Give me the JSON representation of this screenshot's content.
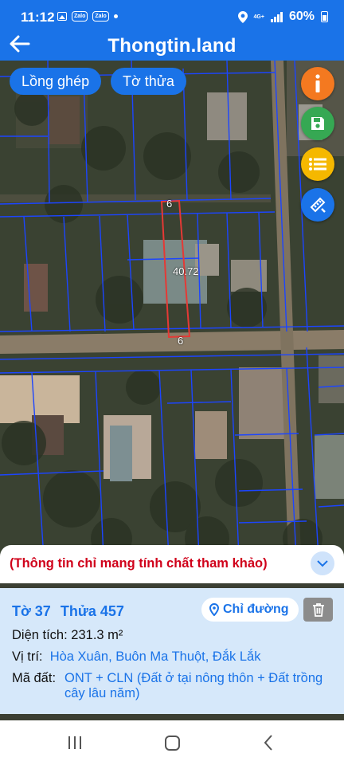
{
  "status_bar": {
    "time": "11:12",
    "notifications": [
      "gallery-icon",
      "zalo-icon",
      "zalo-icon"
    ],
    "zalo_label": "Zalo",
    "network": "4G+",
    "battery": "60%"
  },
  "app_bar": {
    "title": "Thongtin.land"
  },
  "map": {
    "chips": {
      "overlay": "Lồng ghép",
      "parcel": "Tờ thửa"
    },
    "fab_colors": [
      "#f47920",
      "#36a853",
      "#f5b800",
      "#1a73e8"
    ],
    "labels": {
      "top_width": "6",
      "side_length": "40.72",
      "bottom_width": "6"
    }
  },
  "info_panel": {
    "notice": "(Thông tin chỉ mang tính chất tham khảo)",
    "sheet_label": "Tờ 37",
    "parcel_label": "Thửa 457",
    "directions_button": "Chỉ đường",
    "area_key": "Diện tích:",
    "area_value": "231.3 m²",
    "location_key": "Vị trí:",
    "location_value": "Hòa Xuân, Buôn Ma Thuột, Đắk Lắk",
    "land_code_key": "Mã đất:",
    "land_code_line1": "ONT + CLN (Đất ở tại nông thôn + Đất trồng",
    "land_code_line2": "cây lâu năm)"
  },
  "colors": {
    "primary": "#1a73e8",
    "warning": "#d0021b",
    "panel": "#d6e8fa",
    "parcel_highlight": "#e53935"
  }
}
